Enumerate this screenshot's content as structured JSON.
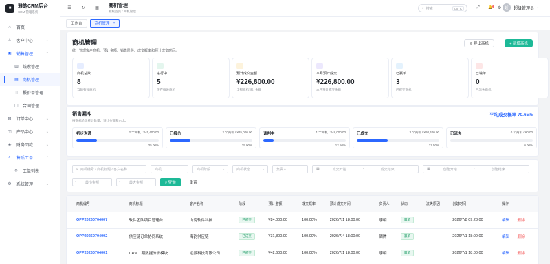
{
  "app": {
    "logo_char": "■",
    "title": "雅韵CRM后台",
    "subtitle": "CRM 管理系统"
  },
  "sidebar": {
    "items": [
      {
        "icon": "⌂",
        "label": "首页"
      },
      {
        "icon": "♙",
        "label": "客户中心",
        "chevron": "⌄"
      },
      {
        "icon": "▣",
        "label": "销售管理",
        "chevron": "⌃"
      },
      {
        "icon": "▥",
        "label": "线索管理"
      },
      {
        "icon": "▤",
        "label": "商机管理"
      },
      {
        "icon": "▯",
        "label": "报价单管理"
      },
      {
        "icon": "▢",
        "label": "合同管理"
      },
      {
        "icon": "⊟",
        "label": "订单中心",
        "chevron": "⌄"
      },
      {
        "icon": "◫",
        "label": "产品中心",
        "chevron": "⌄"
      },
      {
        "icon": "◈",
        "label": "财务回款",
        "chevron": "⌄"
      },
      {
        "icon": "⌕",
        "label": "售后工单",
        "chevron": "⌃"
      },
      {
        "icon": "⟳",
        "label": "工单列表"
      },
      {
        "icon": "⚙",
        "label": "系统管理",
        "chevron": "⌄"
      }
    ]
  },
  "topbar": {
    "menu_icon": "☰",
    "refresh_icon": "↻",
    "grid_icon": "▦",
    "title": "商机管理",
    "breadcrumb": "系统首页 / 商机管理",
    "search_placeholder": "搜索",
    "search_shortcut": "Ctrl K",
    "fullscreen_icon": "⤢",
    "bell_icon": "🔔",
    "settings_icon": "⚙",
    "avatar": "超",
    "username": "超级管理员",
    "user_chevron": "⌄"
  },
  "tabs": [
    {
      "label": "工作台"
    },
    {
      "label": "商机管理",
      "close": "×"
    }
  ],
  "header": {
    "title": "商机管理",
    "desc": "统一管理客户商机、预计金额、销售阶段、成交概率和预计成交时间。",
    "export_label": "⇩ 导出商机",
    "new_label": "+ 新增商机"
  },
  "stats": [
    {
      "label": "商机总数",
      "value": "8",
      "sub": "当前有效商机",
      "color": "#e6edff"
    },
    {
      "label": "进行中",
      "value": "5",
      "sub": "正在推进商机",
      "color": "#e4f6ee"
    },
    {
      "label": "预计成交金额",
      "value": "¥226,800.00",
      "sub": "全部商机预计金额",
      "color": "#fdf3dc"
    },
    {
      "label": "本月预计成交",
      "value": "¥226,800.00",
      "sub": "本月预计成交金额",
      "color": "#ece8fd"
    },
    {
      "label": "已赢单",
      "value": "3",
      "sub": "已成交商机",
      "color": "#e4f2fd"
    },
    {
      "label": "已输单",
      "value": "0",
      "sub": "已流失商机",
      "color": "#fde6e6"
    }
  ],
  "funnel": {
    "title": "销售漏斗",
    "desc": "按商机阶段统计数量、预计金额和占比。",
    "avg_rate": "平均成交概率 70.65%",
    "stages": [
      {
        "name": "初步沟通",
        "info": "2 个商机 / ¥45,400.00",
        "pct_label": "25.00%",
        "pct": 25
      },
      {
        "name": "已报价",
        "info": "2 个商机 / ¥35,000.00",
        "pct_label": "25.00%",
        "pct": 25
      },
      {
        "name": "谈判中",
        "info": "1 个商机 / ¥48,000.00",
        "pct_label": "12.50%",
        "pct": 12.5
      },
      {
        "name": "已成交",
        "info": "3 个商机 / ¥98,400.00",
        "pct_label": "37.50%",
        "pct": 37.5
      },
      {
        "name": "已流失",
        "info": "0 个商机 / ¥0.00",
        "pct_label": "0.00%",
        "pct": 0
      }
    ]
  },
  "filters": {
    "keyword": "商机编号 / 商机标题 / 客户名称",
    "product": "商机",
    "stage": "商机阶段",
    "status": "商机状态",
    "owner": "负责人",
    "expect_start": "成交开始",
    "expect_end": "成交结束",
    "create_start": "创建开始",
    "create_end": "创建结束",
    "range_sep": "-",
    "min_amount": "最小金额",
    "max_amount": "最大金额",
    "query_label": "⌕ 查询",
    "reset_label": "重置",
    "calendar_icon": "▦",
    "dropdown_icon": "⌄",
    "search_icon": "⌕"
  },
  "table": {
    "headers": [
      "商机编号",
      "商机标题",
      "客户名称",
      "阶段",
      "预计金额",
      "成交概率",
      "预计成交时间",
      "负责人",
      "状态",
      "流失原因",
      "创建时间",
      "操作"
    ],
    "rows": [
      [
        "OPP20260704007",
        "软件团队项目管理台",
        "山海软件科技",
        "已成交",
        "¥24,000.00",
        "100.00%",
        "2026/7/1 18:00:00",
        "李明",
        "赢单",
        "",
        "2026/7/8 09:28:00"
      ],
      [
        "OPP20260704002",
        "供应链订单协同系统",
        "海韵供应链",
        "已成交",
        "¥31,800.00",
        "100.00%",
        "2026/7/4 18:00:00",
        "周腾",
        "赢单",
        "",
        "2026/7/1 18:00:00"
      ],
      [
        "OPP20260704001",
        "CRM二期数据分析模块",
        "远景科技有限公司",
        "已成交",
        "¥42,600.00",
        "100.00%",
        "2026/7/1 18:00:00",
        "李明",
        "赢单",
        "",
        "2026/7/1 18:00:00"
      ]
    ],
    "edit_label": "编辑",
    "delete_label": "删除"
  }
}
